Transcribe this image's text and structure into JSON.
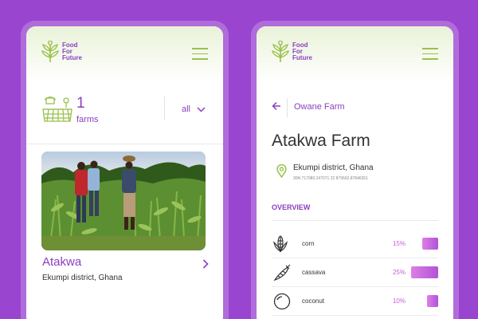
{
  "brand": {
    "line1": "Food",
    "line2": "For",
    "line3": "Future",
    "color": "#8a3fc0",
    "leaf_color": "#9bc04b"
  },
  "list_screen": {
    "count": "1",
    "count_label": "farms",
    "filter_value": "all",
    "card": {
      "name": "Atakwa",
      "location": "Ekumpi district, Ghana"
    }
  },
  "detail_screen": {
    "back_label": "Owane Farm",
    "title": "Atakwa Farm",
    "location": "Ekumpi district, Ghana",
    "coords": "30N 717080.247071 22 879592.87846351",
    "section": "OVERVIEW",
    "crops": [
      {
        "name": "corn",
        "percent": "15%",
        "share": 0.15,
        "icon": "corn-icon"
      },
      {
        "name": "cassava",
        "percent": "25%",
        "share": 0.25,
        "icon": "cassava-icon"
      },
      {
        "name": "coconut",
        "percent": "10%",
        "share": 0.1,
        "icon": "coconut-icon"
      }
    ]
  }
}
